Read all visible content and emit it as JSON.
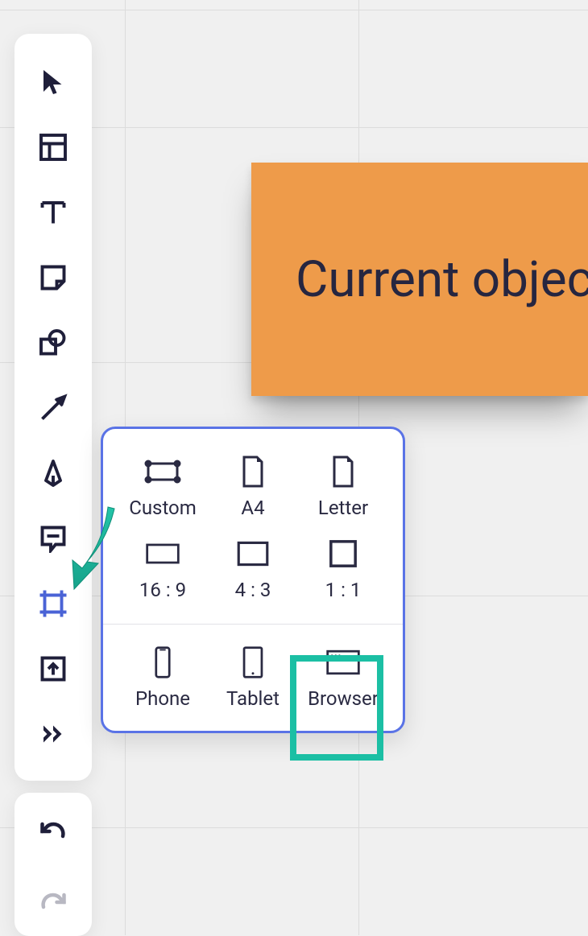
{
  "canvas": {
    "sticky_text": "Current objectiv"
  },
  "toolbar": {
    "tools": [
      {
        "name": "select-tool",
        "icon": "cursor"
      },
      {
        "name": "template-tool",
        "icon": "layout"
      },
      {
        "name": "text-tool",
        "icon": "text"
      },
      {
        "name": "sticky-note-tool",
        "icon": "sticky"
      },
      {
        "name": "shapes-tool",
        "icon": "shapes"
      },
      {
        "name": "line-tool",
        "icon": "arrow-line"
      },
      {
        "name": "pen-tool",
        "icon": "pen"
      },
      {
        "name": "comment-tool",
        "icon": "comment"
      },
      {
        "name": "frame-tool",
        "icon": "frame",
        "active": true
      },
      {
        "name": "upload-tool",
        "icon": "upload-frame"
      },
      {
        "name": "more-tools",
        "icon": "chevrons"
      }
    ]
  },
  "undo_redo": {
    "undo": "undo",
    "redo": "redo"
  },
  "frame_picker": {
    "items": [
      {
        "name": "frame-custom",
        "label": "Custom",
        "icon": "custom-frame"
      },
      {
        "name": "frame-a4",
        "label": "A4",
        "icon": "page-a4"
      },
      {
        "name": "frame-letter",
        "label": "Letter",
        "icon": "page-letter"
      },
      {
        "name": "frame-16-9",
        "label": "16 : 9",
        "icon": "ratio-16-9"
      },
      {
        "name": "frame-4-3",
        "label": "4 : 3",
        "icon": "ratio-4-3"
      },
      {
        "name": "frame-1-1",
        "label": "1 : 1",
        "icon": "ratio-1-1"
      },
      {
        "name": "frame-phone",
        "label": "Phone",
        "icon": "phone"
      },
      {
        "name": "frame-tablet",
        "label": "Tablet",
        "icon": "tablet"
      },
      {
        "name": "frame-browser",
        "label": "Browser",
        "icon": "browser",
        "highlighted": true
      }
    ],
    "highlight_color": "#1bbfa4",
    "border_color": "#5a73e6"
  },
  "annotation_arrow_color": "#1bbfa4"
}
